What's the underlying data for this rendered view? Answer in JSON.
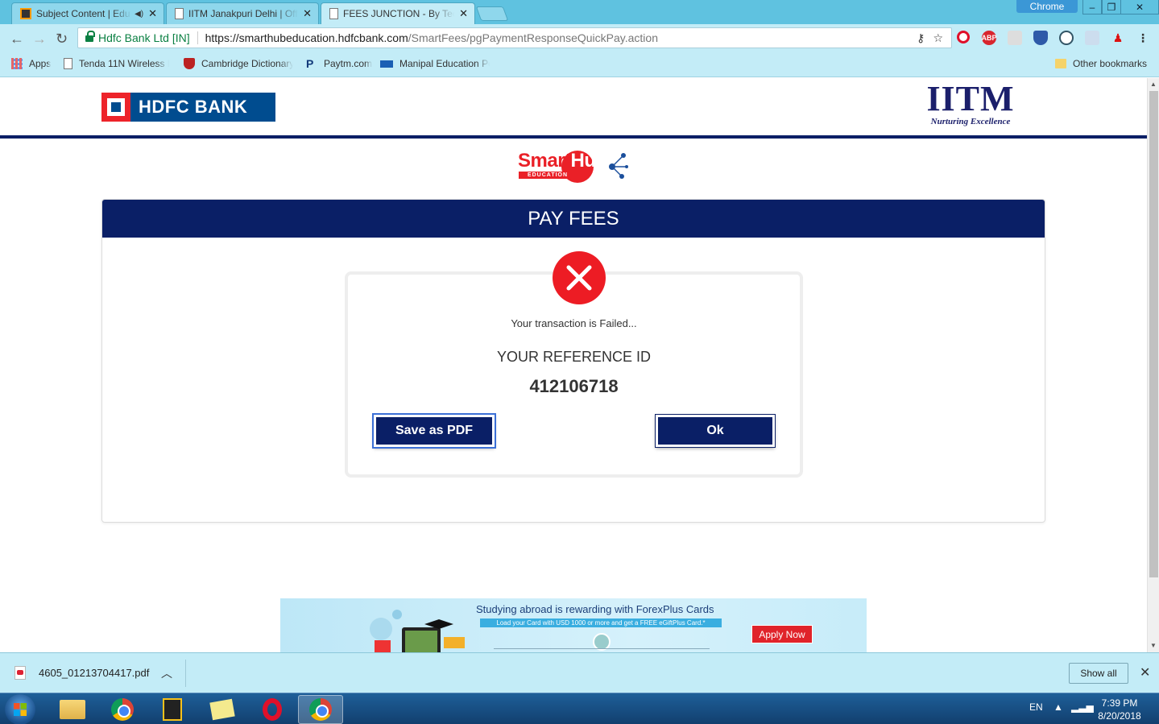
{
  "browser": {
    "tabs": [
      {
        "title": "Subject Content | Edu",
        "active": false
      },
      {
        "title": "IITM Janakpuri Delhi | Off",
        "active": false
      },
      {
        "title": "FEES JUNCTION - By Tech",
        "active": true
      }
    ],
    "profile_badge": "Chrome",
    "address": {
      "site_identity": "Hdfc Bank Ltd [IN]",
      "url_host": "https://smarthubeducation.hdfcbank.com",
      "url_path": "/SmartFees/pgPaymentResponseQuickPay.action"
    },
    "bookmarks": [
      {
        "label": "Apps",
        "icon": "apps-grid-icon"
      },
      {
        "label": "Tenda 11N Wireless R",
        "icon": "page-icon"
      },
      {
        "label": "Cambridge Dictionary",
        "icon": "cambridge-icon"
      },
      {
        "label": "Paytm.com",
        "icon": "paytm-icon"
      },
      {
        "label": "Manipal Education Po",
        "icon": "sap-icon"
      }
    ],
    "other_bookmarks": "Other bookmarks"
  },
  "page": {
    "bank_logo": "HDFC BANK",
    "institute_logo": "IITM",
    "institute_tagline": "Nurturing Excellence",
    "brand": {
      "smart": "Smart",
      "hub": "Hub",
      "sub": "EDUCATION"
    },
    "card_title": "PAY FEES",
    "status_message": "Your transaction is Failed...",
    "reference_label": "YOUR REFERENCE ID",
    "reference_id": "412106718",
    "buttons": {
      "save_pdf": "Save as PDF",
      "ok": "Ok"
    },
    "banner": {
      "title": "Studying abroad is rewarding with ForexPlus Cards",
      "subtitle": "Load your Card with USD 1000 or more and get a FREE eGiftPlus Card.*",
      "cta": "Apply Now"
    }
  },
  "download_shelf": {
    "file": "4605_01213704417.pdf",
    "show_all": "Show all"
  },
  "taskbar": {
    "language": "EN",
    "time": "7:39 PM",
    "date": "8/20/2018"
  },
  "colors": {
    "navy": "#0a1f66",
    "hdfc_blue": "#004c8f",
    "hdfc_red": "#ed232a",
    "fail_red": "#ed1c24",
    "chrome_theme": "#5fc2e0"
  }
}
